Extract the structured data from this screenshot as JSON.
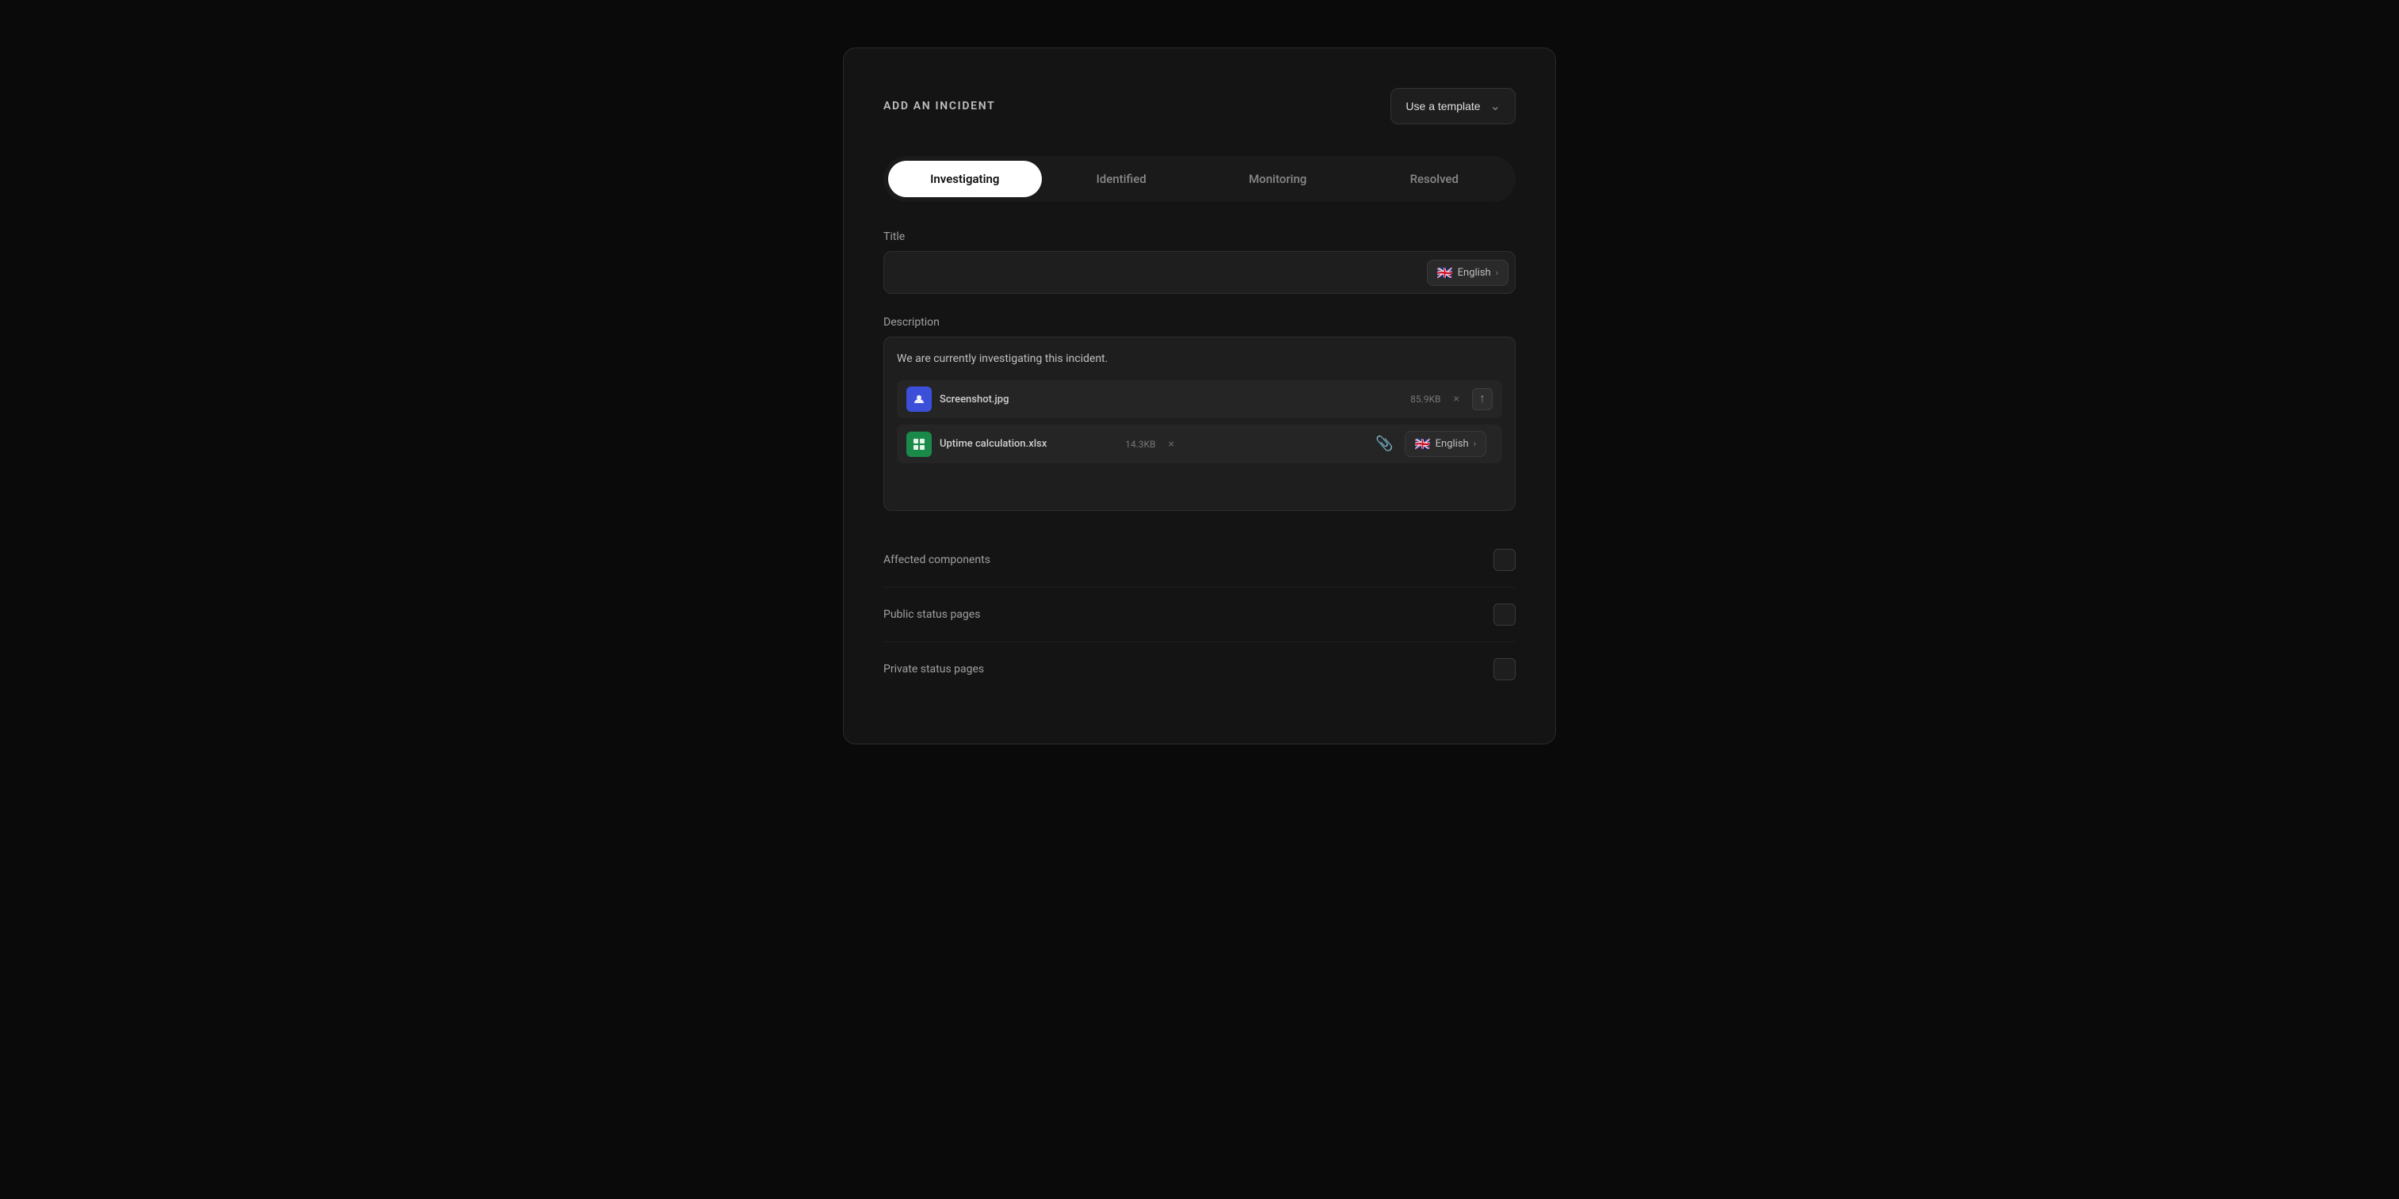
{
  "page": {
    "background": "#0a0a0a"
  },
  "modal": {
    "title": "ADD AN INCIDENT",
    "template_button": "Use a template"
  },
  "status_tabs": [
    {
      "id": "investigating",
      "label": "Investigating",
      "active": true
    },
    {
      "id": "identified",
      "label": "Identified",
      "active": false
    },
    {
      "id": "monitoring",
      "label": "Monitoring",
      "active": false
    },
    {
      "id": "resolved",
      "label": "Resolved",
      "active": false
    }
  ],
  "title_field": {
    "label": "Title",
    "placeholder": "",
    "value": "",
    "lang_label": "English"
  },
  "description_field": {
    "label": "Description",
    "value": "We are currently investigating this incident.",
    "lang_label": "English"
  },
  "files": [
    {
      "name": "Screenshot.jpg",
      "size": "85.9KB",
      "icon_type": "blue",
      "icon_char": "👤"
    },
    {
      "name": "Uptime calculation.xlsx",
      "size": "14.3KB",
      "icon_type": "green",
      "icon_char": "▦"
    }
  ],
  "settings": [
    {
      "id": "affected-components",
      "label": "Affected components"
    },
    {
      "id": "public-status-pages",
      "label": "Public status pages"
    },
    {
      "id": "private-status-pages",
      "label": "Private status pages"
    }
  ],
  "icons": {
    "chevron_down": "⌄",
    "chevron_right": "›",
    "upload": "↑",
    "attach": "📎",
    "flag_uk": "🇬🇧"
  }
}
